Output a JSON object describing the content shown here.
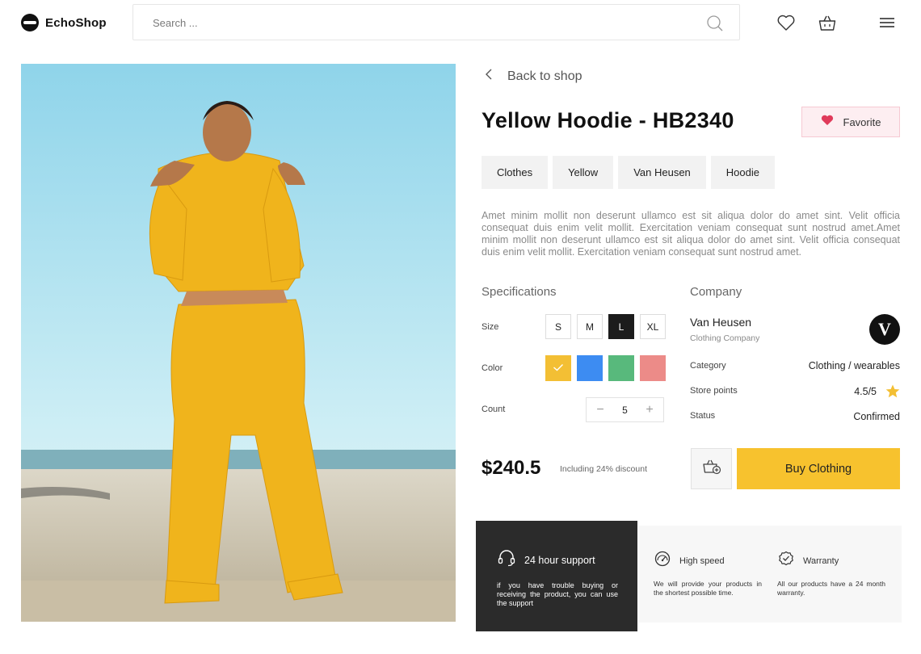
{
  "header": {
    "brand": "EchoShop",
    "search_placeholder": "Search ...",
    "icons": [
      "search-icon",
      "heart-icon",
      "basket-icon",
      "menu-icon"
    ]
  },
  "nav": {
    "back_label": "Back to shop"
  },
  "product": {
    "title": "Yellow Hoodie - HB2340",
    "favorite_label": "Favorite",
    "tags": [
      "Clothes",
      "Yellow",
      "Van Heusen",
      "Hoodie"
    ],
    "description": "Amet minim mollit non deserunt ullamco est sit aliqua dolor do amet sint. Velit officia consequat duis enim velit mollit. Exercitation veniam consequat sunt nostrud amet.Amet minim mollit non deserunt ullamco est sit aliqua dolor do amet sint. Velit officia consequat duis enim velit mollit. Exercitation veniam consequat sunt nostrud amet.",
    "price": "$240.5",
    "discount_note": "Including 24% discount",
    "buy_label": "Buy Clothing"
  },
  "specifications": {
    "title": "Specifications",
    "size_label": "Size",
    "sizes": [
      "S",
      "M",
      "L",
      "XL"
    ],
    "selected_size": "L",
    "color_label": "Color",
    "colors": [
      "#f3bf34",
      "#3d8cf2",
      "#58b97c",
      "#ec8b88"
    ],
    "selected_color_index": 0,
    "count_label": "Count",
    "count": "5",
    "count_minus": "−",
    "count_plus": "+"
  },
  "company": {
    "title": "Company",
    "name": "Van Heusen",
    "subtitle": "Clothing Company",
    "logo_letter": "V",
    "category_label": "Category",
    "category_value": "Clothing / wearables",
    "points_label": "Store points",
    "points_value": "4.5/5",
    "status_label": "Status",
    "status_value": "Confirmed"
  },
  "features": [
    {
      "title": "24 hour support",
      "desc": "if you have trouble buying or receiving the product, you can use the support",
      "icon": "headset-icon"
    },
    {
      "title": "High speed",
      "desc": "We will provide your products in the shortest possible time.",
      "icon": "speedometer-icon"
    },
    {
      "title": "Warranty",
      "desc": "All our products have a 24 month warranty.",
      "icon": "check-circle-icon"
    }
  ],
  "colors": {
    "accent": "#f7c22e",
    "favorite": "#e03a5a",
    "dark": "#2b2b2b",
    "star": "#f3bf34"
  }
}
